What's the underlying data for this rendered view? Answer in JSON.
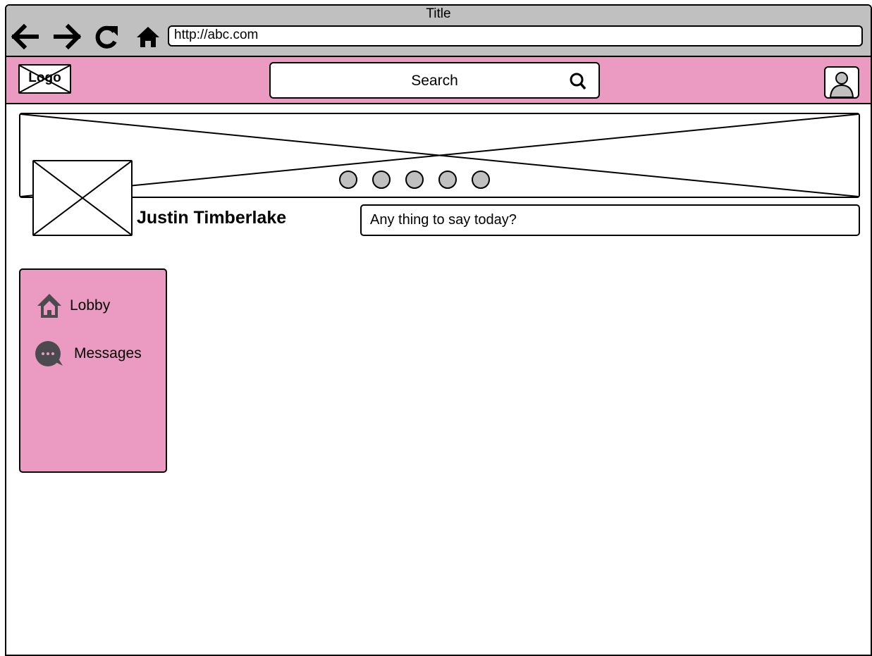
{
  "browser": {
    "title": "Title",
    "url": "http://abc.com",
    "nav": {
      "back_icon": "arrow-left-icon",
      "forward_icon": "arrow-right-icon",
      "reload_icon": "reload-icon",
      "home_icon": "home-icon"
    }
  },
  "header": {
    "logo_text": "Logo",
    "search_label": "Search",
    "search_icon": "search-icon",
    "user_icon": "user-icon",
    "background_color": "#eb9bc2"
  },
  "profile": {
    "name": "Justin Timberlake",
    "status_placeholder": "Any thing to say today?",
    "carousel_dots": 5
  },
  "sidebar": {
    "items": [
      {
        "label": "Lobby",
        "icon": "house-icon"
      },
      {
        "label": "Messages",
        "icon": "chat-bubble-icon"
      }
    ]
  },
  "colors": {
    "accent": "#eb9bc2",
    "chrome": "#c0c0c0",
    "icon": "#4a4a4f"
  }
}
